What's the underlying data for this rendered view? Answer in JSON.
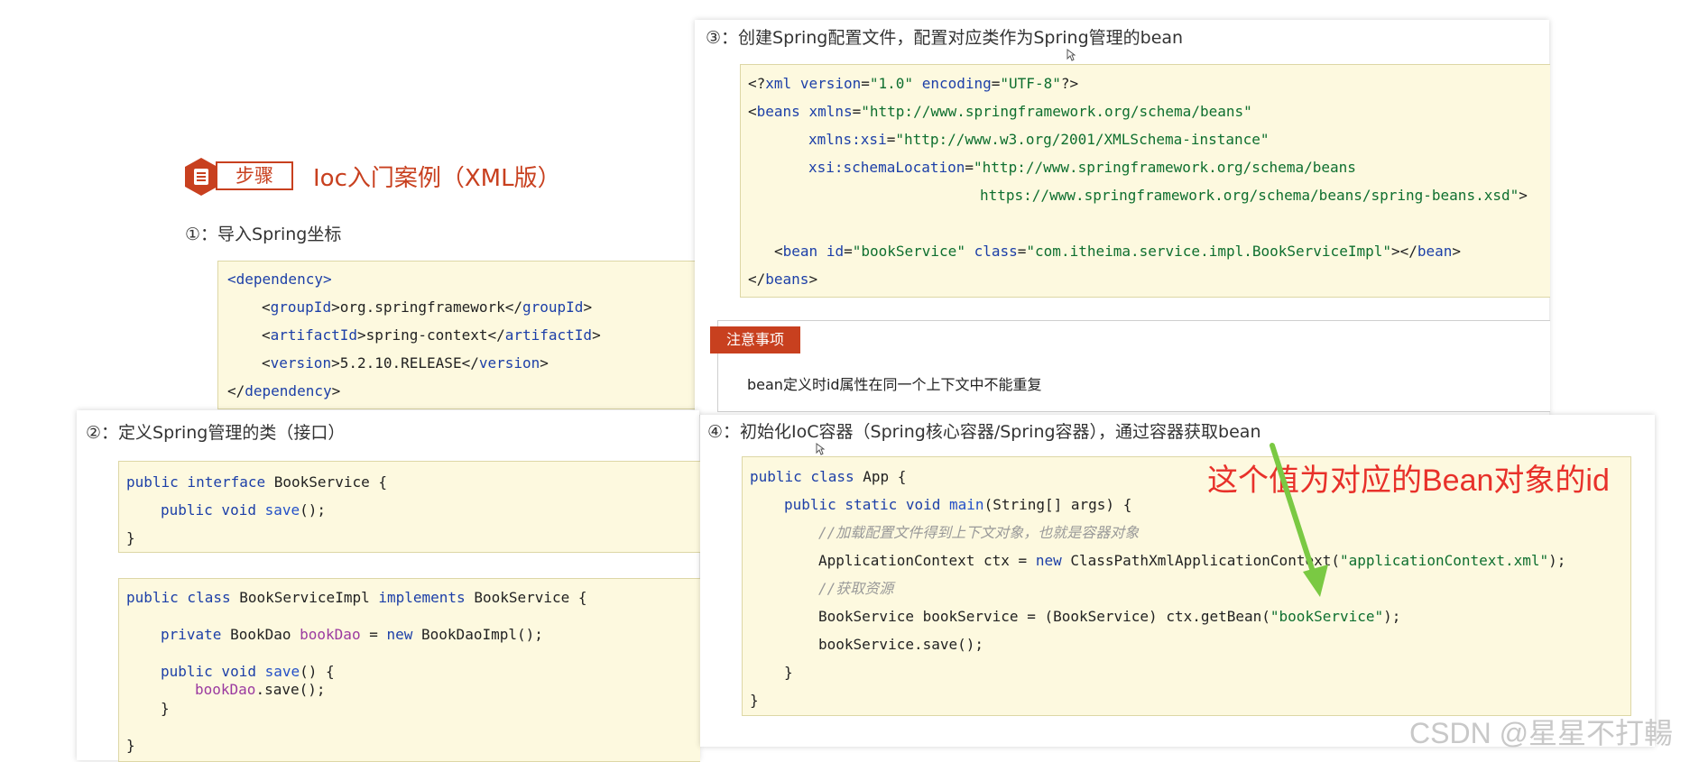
{
  "panel1": {
    "step_label": "步骤",
    "title": "Ioc入门案例（XML版）",
    "step1_title": "①：导入Spring坐标",
    "dependency": {
      "open": "<dependency>",
      "group": "<groupId>org.springframework</groupId>",
      "artifact": "<artifactId>spring-context</artifactId>",
      "version": "<version>5.2.10.RELEASE</version>",
      "close": "</dependency>"
    }
  },
  "panel2": {
    "step2_title": "②：定义Spring管理的类（接口）"
  },
  "panel3": {
    "step3_title": "③：创建Spring配置文件，配置对应类作为Spring管理的bean"
  },
  "note": {
    "badge": "注意事项",
    "text": "bean定义时id属性在同一个上下文中不能重复"
  },
  "panel4": {
    "step4_title": "④：初始化IoC容器（Spring核心容器/Spring容器），通过容器获取bean",
    "comment1": "//加载配置文件得到上下文对象，也就是容器对象",
    "comment2": "//获取资源"
  },
  "annotation": {
    "text": "这个值为对应的Bean对象的id",
    "color": "#e8312a",
    "arrow_color": "#7ac943"
  },
  "watermark": "CSDN @星星不打輰",
  "colors": {
    "step_badge": "#c8401f",
    "note_badge": "#c8401f",
    "code_bg": "#fdf9df"
  }
}
